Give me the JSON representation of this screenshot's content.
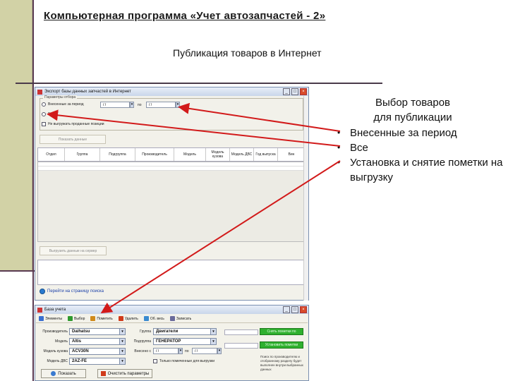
{
  "slide": {
    "title": "Компьютерная программа «Учет автозапчастей - 2»",
    "subtitle": "Публикация товаров в Интернет"
  },
  "right_panel": {
    "heading_line1": "Выбор товаров",
    "heading_line2": "для публикации",
    "bullets": [
      "Внесенные за период",
      "Все",
      "Установка и снятие пометки на выгрузку"
    ]
  },
  "window1": {
    "title": "Экспорт базы данных запчастей в Интернет",
    "group_label": "Параметры отбора",
    "radio_period": "Внесенные за период",
    "radio_all": "Все",
    "date_from": "/ /",
    "date_sep": "по",
    "date_to": "/ /",
    "checkbox_label": "Не выгружать проданные позиции",
    "show_button": "Показать данные",
    "columns": [
      "Отдел",
      "Группа",
      "Подгруппа",
      "Производитель",
      "Модель",
      "Модель кузова",
      "Модель ДВС",
      "Год выпуска",
      "Вин"
    ],
    "export_button": "Выгрузить данные на сервер",
    "link_text": "Перейти на страницу поиска"
  },
  "window2": {
    "title": "База учета",
    "toolbar": [
      {
        "label": "Элементы",
        "icon": "list-icon",
        "color": "#3a6fd0"
      },
      {
        "label": "Выбор",
        "icon": "check-icon",
        "color": "#2f9a2f"
      },
      {
        "label": "Пометить",
        "icon": "pencil-icon",
        "color": "#d08a1a"
      },
      {
        "label": "Удалить",
        "icon": "delete-icon",
        "color": "#d03a1a"
      },
      {
        "label": "Об. весь",
        "icon": "refresh-icon",
        "color": "#3a8ad0"
      },
      {
        "label": "Записать",
        "icon": "save-icon",
        "color": "#6a6a9a"
      }
    ],
    "label_manufacturer": "Производитель",
    "manufacturer": "Daihatsu",
    "label_model": "Модель",
    "model": "Altis",
    "label_body": "Модель кузова",
    "body_model": "ACV30N",
    "label_engine": "Модель ДВС",
    "engine_model": "2AZ-FE",
    "label_group": "Группа",
    "group": "Двигатели",
    "label_subgroup": "Подгруппа",
    "subgroup": "ГЕНЕРАТОР",
    "label_date": "Внесено с",
    "date_from": "/ /",
    "date_sep": "по",
    "date_to": "/ /",
    "only_marked": "Только помеченные для выгрузки",
    "green_btn1": "Снять пометки по запросу",
    "green_btn2": "Установить пометки",
    "note": "Поиск по производителю и отобранному разделу будет выполнен внутри выбранных данных",
    "btn_search": "Показать",
    "btn_clear": "Очистить параметры"
  },
  "colors": {
    "left_band": "#d2d2a6",
    "arrow_red": "#d21a1a"
  }
}
